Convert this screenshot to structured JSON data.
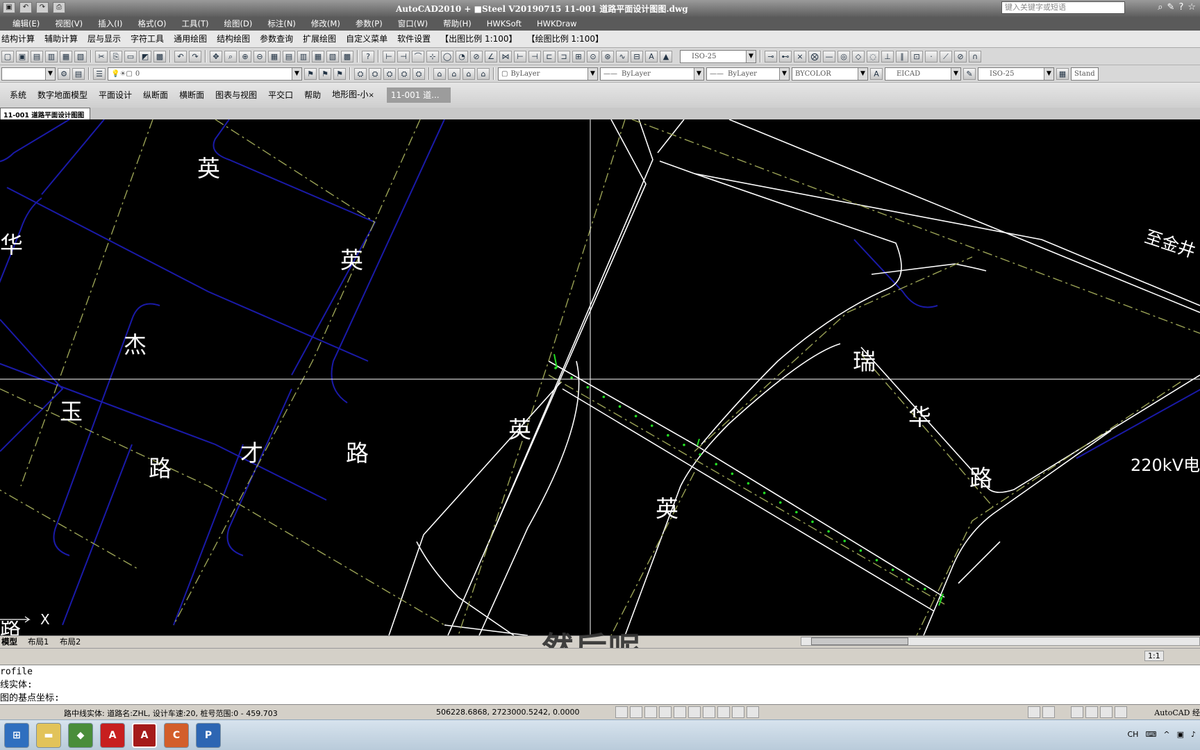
{
  "titlebar": {
    "title": "AutoCAD2010 + ■Steel V20190715   11-001 道路平面设计图图.dwg",
    "search_placeholder": "键入关键字或短语"
  },
  "menubar": [
    "编辑(E)",
    "视图(V)",
    "插入(I)",
    "格式(O)",
    "工具(T)",
    "绘图(D)",
    "标注(N)",
    "修改(M)",
    "参数(P)",
    "窗口(W)",
    "帮助(H)",
    "HWKSoft",
    "HWKDraw"
  ],
  "custom_menu": [
    "结构计算",
    "辅助计算",
    "层与显示",
    "字符工具",
    "通用绘图",
    "结构绘图",
    "参数查询",
    "扩展绘图",
    "自定义菜单",
    "软件设置",
    "【出图比例 1:100】",
    "【绘图比例 1:100】"
  ],
  "toolbar2": {
    "layer_value": "0",
    "color": "ByLayer",
    "linetype": "ByLayer",
    "lineweight": "ByLayer",
    "plotstyle": "BYCOLOR",
    "textstyle": "EICAD",
    "dimstyle": "ISO-25",
    "dimstyle_top": "ISO-25",
    "standard": "Stand"
  },
  "ribbon": {
    "tabs": [
      "系统",
      "数字地面模型",
      "平面设计",
      "纵断面",
      "横断面",
      "图表与视图",
      "平交口",
      "帮助"
    ],
    "doc_tab_1": "地形图-小",
    "doc_tab_1_close": "×",
    "doc_tab_2": "11-001 道..."
  },
  "doc_tab": "11-001 道路平面设计图图",
  "canvas_labels": {
    "l1": "英",
    "l2": "华",
    "l3": "英",
    "l4": "杰",
    "l5": "玉",
    "l6": "路",
    "l7": "才",
    "l8": "路",
    "l9": "英",
    "l10": "英",
    "l11": "瑞",
    "l12": "华",
    "l13": "路",
    "l14": "至金井",
    "l15": "220kV电",
    "l16": "路"
  },
  "ucs_label": "X",
  "layout_tabs": [
    "模型",
    "布局1",
    "布局2"
  ],
  "subtitle": "然后呢",
  "annotation_scale": "1:1",
  "command_lines": [
    "rofile",
    "线实体:",
    "图的基点坐标:"
  ],
  "status": {
    "message": "路中线实体: 道路名:ZHL, 设计车速:20, 桩号范围:0 - 459.703",
    "coordinates": "506228.6868, 2723000.5242, 0.0000",
    "app": "AutoCAD 经"
  },
  "taskbar": {
    "lang": "CH"
  },
  "colors": {
    "road_edge": "#1a1aa8",
    "road_line": "#ffffff",
    "centerline": "#9aa255",
    "stake": "#22dd22",
    "background": "#000000"
  }
}
